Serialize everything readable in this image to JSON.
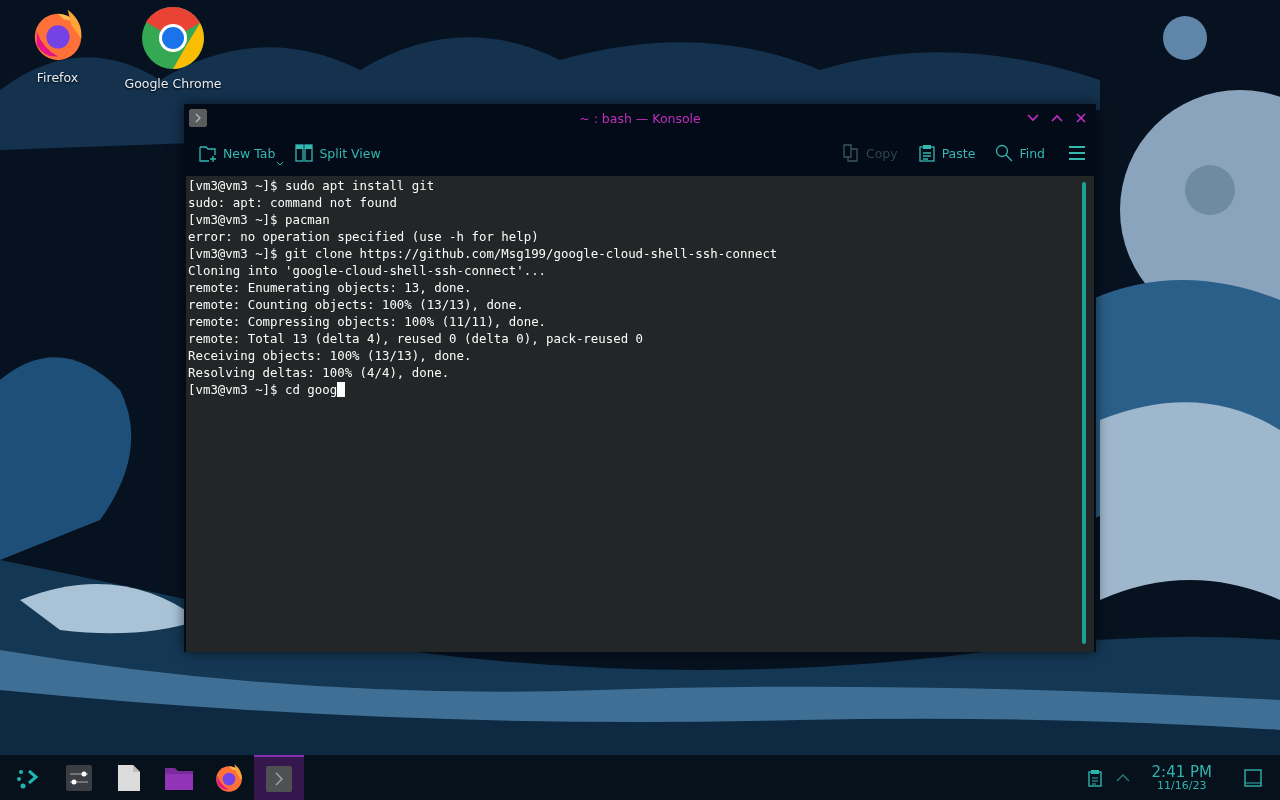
{
  "desktop_icons": [
    {
      "kind": "firefox",
      "label": "Firefox"
    },
    {
      "kind": "chrome",
      "label": "Google Chrome"
    }
  ],
  "window": {
    "title": "~ : bash — Konsole",
    "toolbar_left": [
      {
        "kind": "new-tab",
        "label": "New Tab",
        "disabled": false
      },
      {
        "kind": "split",
        "label": "Split View",
        "disabled": false
      }
    ],
    "toolbar_right": [
      {
        "kind": "copy",
        "label": "Copy",
        "disabled": true
      },
      {
        "kind": "paste",
        "label": "Paste",
        "disabled": false
      },
      {
        "kind": "find",
        "label": "Find",
        "disabled": false
      }
    ],
    "terminal": {
      "lines": [
        "[vm3@vm3 ~]$ sudo apt install git",
        "sudo: apt: command not found",
        "[vm3@vm3 ~]$ pacman",
        "error: no operation specified (use -h for help)",
        "[vm3@vm3 ~]$ git clone https://github.com/Msg199/google-cloud-shell-ssh-connect",
        "Cloning into 'google-cloud-shell-ssh-connect'...",
        "remote: Enumerating objects: 13, done.",
        "remote: Counting objects: 100% (13/13), done.",
        "remote: Compressing objects: 100% (11/11), done.",
        "remote: Total 13 (delta 4), reused 0 (delta 0), pack-reused 0",
        "Receiving objects: 100% (13/13), done.",
        "Resolving deltas: 100% (4/4), done.",
        "[vm3@vm3 ~]$ cd goog"
      ],
      "cursor": true
    }
  },
  "taskbar": {
    "items": [
      {
        "kind": "launcher",
        "selected": false
      },
      {
        "kind": "settings",
        "selected": false
      },
      {
        "kind": "document",
        "selected": false
      },
      {
        "kind": "folder",
        "selected": false
      },
      {
        "kind": "firefox",
        "selected": false
      },
      {
        "kind": "konsole",
        "selected": true
      }
    ],
    "clock": {
      "time": "2:41 PM",
      "date": "11/16/23"
    }
  }
}
